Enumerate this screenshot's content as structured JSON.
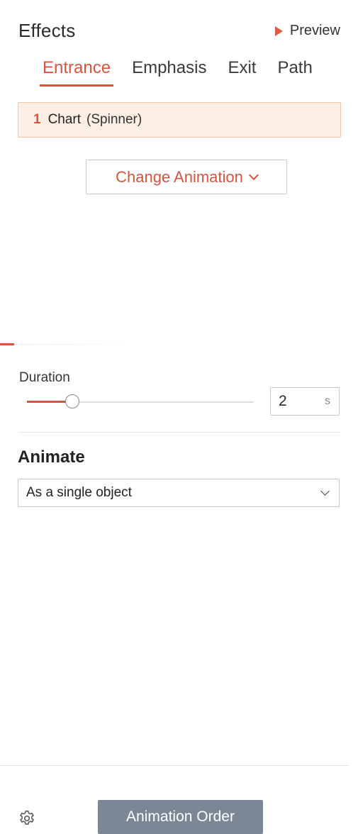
{
  "header": {
    "title": "Effects",
    "preview_label": "Preview"
  },
  "tabs": [
    {
      "label": "Entrance",
      "active": true
    },
    {
      "label": "Emphasis",
      "active": false
    },
    {
      "label": "Exit",
      "active": false
    },
    {
      "label": "Path",
      "active": false
    }
  ],
  "animation_item": {
    "number": "1",
    "name": "Chart",
    "type": "(Spinner)"
  },
  "change_animation": {
    "label": "Change Animation"
  },
  "duration": {
    "label": "Duration",
    "value": "2",
    "unit": "s",
    "slider_fraction": 0.2
  },
  "animate": {
    "heading": "Animate",
    "selected": "As a single object"
  },
  "footer": {
    "order_button_label": "Animation Order",
    "settings_icon": "gear-icon"
  },
  "colors": {
    "accent": "#d9543e",
    "selected_bg": "#fdeee4",
    "button_gray": "#7c8796"
  }
}
